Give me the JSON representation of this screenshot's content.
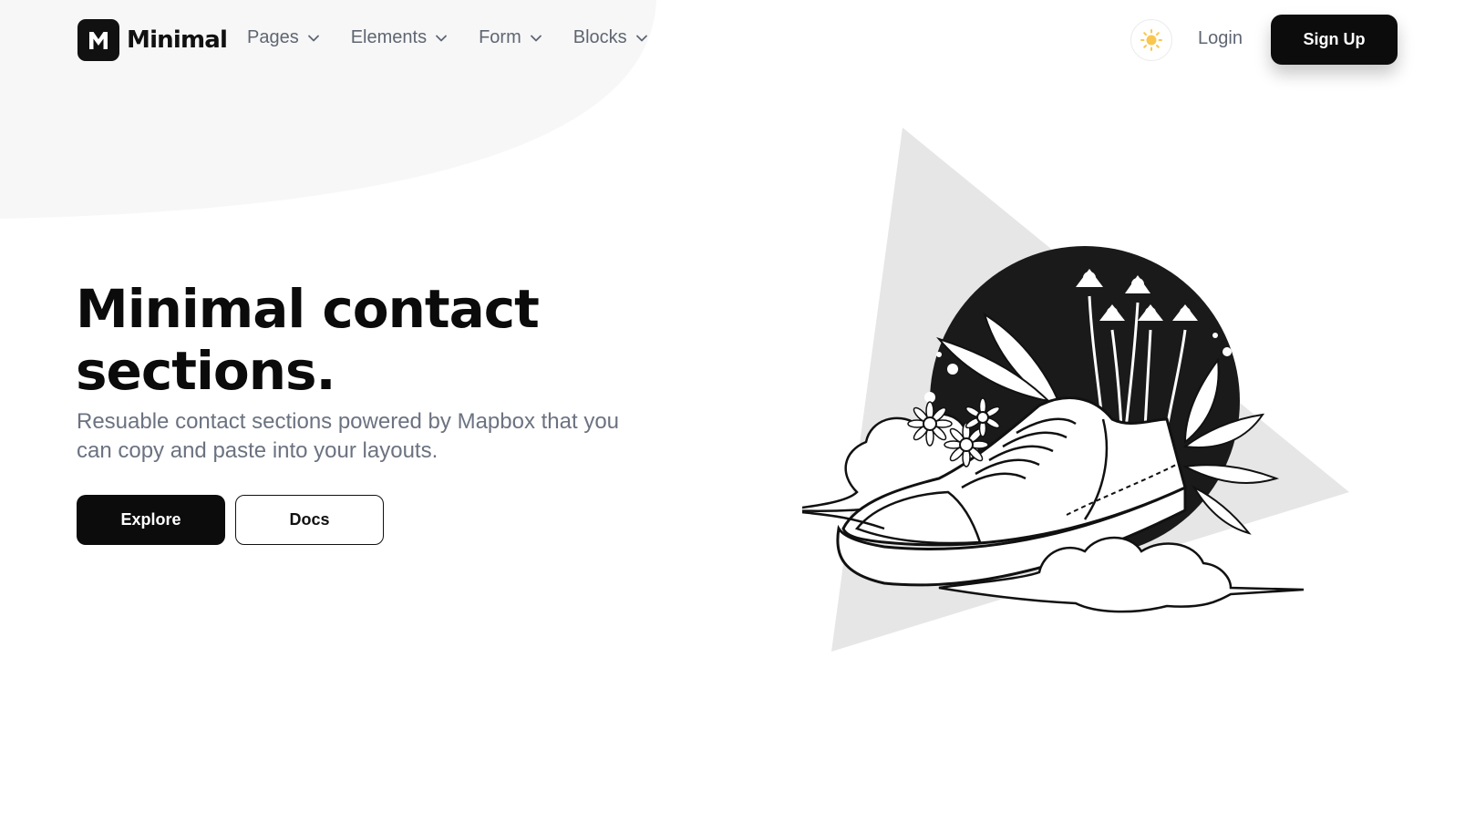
{
  "brand": {
    "name": "Minimal",
    "logo_letter": "M"
  },
  "nav": {
    "items": [
      {
        "label": "Pages",
        "icon": "chevron-down-icon"
      },
      {
        "label": "Elements",
        "icon": "chevron-down-icon"
      },
      {
        "label": "Form",
        "icon": "chevron-down-icon"
      },
      {
        "label": "Blocks",
        "icon": "chevron-down-icon"
      }
    ]
  },
  "header_actions": {
    "theme_icon": "sun-icon",
    "login_label": "Login",
    "signup_label": "Sign Up"
  },
  "hero": {
    "title_line1": "Minimal contact",
    "title_line2": "sections.",
    "subtitle": "Resuable contact sections powered by Mapbox that you can copy and paste into your layouts.",
    "primary_label": "Explore",
    "secondary_label": "Docs"
  },
  "illustration": {
    "name": "sneaker-with-flowers-illustration"
  },
  "colors": {
    "primary": "#0c0c0c",
    "muted_text": "#6b7280",
    "blob_gray": "#f7f7f7",
    "triangle_gray": "#e6e6e6",
    "sun_yellow": "#f9c74f"
  }
}
